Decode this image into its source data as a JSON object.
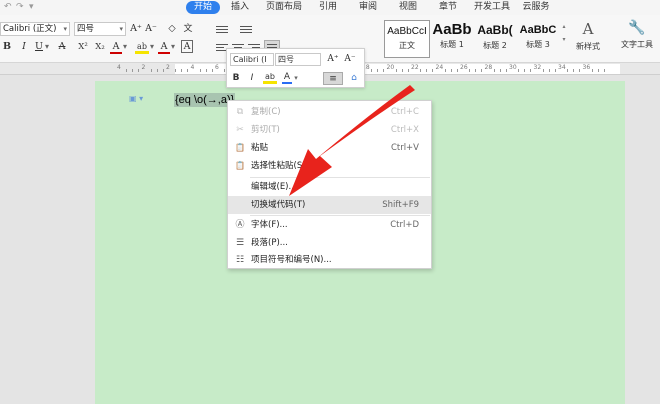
{
  "quick_access": {
    "undo": "↶",
    "redo": "↷",
    "more": "▾"
  },
  "tabs": [
    {
      "label": "开始",
      "active": true
    },
    {
      "label": "插入"
    },
    {
      "label": "页面布局"
    },
    {
      "label": "引用"
    },
    {
      "label": "审阅"
    },
    {
      "label": "视图"
    },
    {
      "label": "章节"
    },
    {
      "label": "开发工具"
    },
    {
      "label": "云服务"
    }
  ],
  "ribbon": {
    "font_name": "Calibri (正文)",
    "font_size": "四号",
    "grow_font": "A⁺",
    "shrink_font": "A⁻",
    "clear_format": "◇",
    "wen": "文",
    "bold": "B",
    "italic": "I",
    "underline": "U",
    "strike": "A",
    "superscript": "X²",
    "subscript": "X₂",
    "font_color_a": "A",
    "highlight": "ab",
    "text_color": "A",
    "char_border": "A",
    "styles": [
      {
        "sample": "AaBbCcI",
        "name": "正文",
        "selected": true
      },
      {
        "sample": "AaBb",
        "name": "标题 1"
      },
      {
        "sample": "AaBb(",
        "name": "标题 2"
      },
      {
        "sample": "AaBbC",
        "name": "标题 3"
      }
    ],
    "new_style": "新样式",
    "text_tools": "文字工具",
    "new_style_icon": "A",
    "text_tools_icon": "wrench-icon"
  },
  "ruler": {
    "numbers": [
      "4",
      "2",
      "2",
      "4",
      "6",
      "8",
      "10",
      "12",
      "14",
      "16",
      "18",
      "20",
      "22",
      "24",
      "26",
      "28",
      "30",
      "32",
      "34",
      "36"
    ]
  },
  "document": {
    "field_code": "{eq \\o(→,a)}",
    "para_marker": "▣ ▾"
  },
  "mini_toolbar": {
    "font_name": "Calibri (I",
    "font_size": "四号",
    "grow": "A⁺",
    "shrink": "A⁻",
    "bold": "B",
    "italic": "I",
    "highlight": "ab",
    "font_color": "A",
    "align": "≡",
    "format_painter": "⌂"
  },
  "context_menu": {
    "items": [
      {
        "label": "复制(C)",
        "shortcut": "Ctrl+C",
        "icon": "copy-icon",
        "glyph": "⧉",
        "disabled": true
      },
      {
        "label": "剪切(T)",
        "shortcut": "Ctrl+X",
        "icon": "cut-icon",
        "glyph": "✂",
        "disabled": true
      },
      {
        "label": "粘贴",
        "shortcut": "Ctrl+V",
        "icon": "paste-icon",
        "glyph": "📋"
      },
      {
        "label": "选择性粘贴(S)...",
        "shortcut": "",
        "icon": "paste-special-icon",
        "glyph": "📋"
      },
      {
        "label": "编辑域(E)...",
        "shortcut": "",
        "icon": "",
        "glyph": ""
      },
      {
        "label": "切换域代码(T)",
        "shortcut": "Shift+F9",
        "icon": "",
        "glyph": "",
        "highlighted": true
      },
      {
        "label": "字体(F)...",
        "shortcut": "Ctrl+D",
        "icon": "font-icon",
        "glyph": "Ⓐ"
      },
      {
        "label": "段落(P)...",
        "shortcut": "",
        "icon": "paragraph-icon",
        "glyph": "☰"
      },
      {
        "label": "项目符号和编号(N)...",
        "shortcut": "",
        "icon": "bullets-icon",
        "glyph": "☷"
      }
    ]
  },
  "colors": {
    "tab_active": "#2f80ed",
    "page_bg": "#c7ebc8",
    "menu_highlight": "#e6e6e6",
    "arrow": "#e8231c"
  }
}
